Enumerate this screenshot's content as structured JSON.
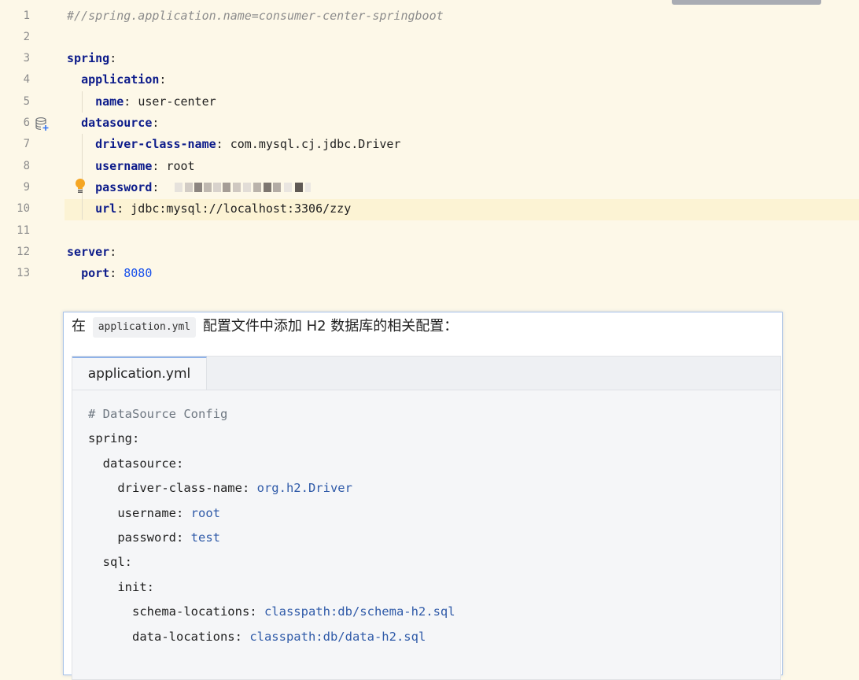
{
  "editor": {
    "line_numbers": [
      "1",
      "2",
      "3",
      "4",
      "5",
      "6",
      "7",
      "8",
      "9",
      "10",
      "11",
      "12",
      "13"
    ],
    "lines": [
      {
        "comment": "#//spring.application.name=consumer-center-springboot"
      },
      {},
      {
        "key": "spring",
        "colon": ":"
      },
      {
        "indent": "  ",
        "key": "application",
        "colon": ":"
      },
      {
        "indent": "    ",
        "key": "name",
        "colon": ": ",
        "value": "user-center"
      },
      {
        "indent": "  ",
        "key": "datasource",
        "colon": ":"
      },
      {
        "indent": "    ",
        "key": "driver-class-name",
        "colon": ": ",
        "value": "com.mysql.cj.jdbc.Driver"
      },
      {
        "indent": "    ",
        "key": "username",
        "colon": ": ",
        "value": "root"
      },
      {
        "indent": "    ",
        "key": "password",
        "colon": ": "
      },
      {
        "indent": "    ",
        "key": "url",
        "colon": ": ",
        "value": "jdbc:mysql://localhost:3306/zzy"
      },
      {},
      {
        "key": "server",
        "colon": ":"
      },
      {
        "indent": "  ",
        "key": "port",
        "colon": ": ",
        "number": "8080"
      }
    ],
    "gutter_icons": [
      "database-icon",
      "lightbulb-icon"
    ],
    "colors": {
      "background": "#fdf8e8",
      "key": "#0c1b8a",
      "number": "#1750eb",
      "comment": "#8c8c8c"
    }
  },
  "popup": {
    "intro_before": "在",
    "intro_code": "application.yml",
    "intro_after": "配置文件中添加 H2 数据库的相关配置：",
    "tab_label": "application.yml",
    "code_lines": [
      {
        "comment": "# DataSource Config"
      },
      {
        "key": "spring:"
      },
      {
        "key": "  datasource:"
      },
      {
        "key": "    driver-class-name: ",
        "value": "org.h2.Driver"
      },
      {
        "key": "    username: ",
        "value": "root"
      },
      {
        "key": "    password: ",
        "value": "test"
      },
      {
        "key": "  sql:"
      },
      {
        "key": "    init:"
      },
      {
        "key": "      schema-locations: ",
        "value": "classpath:db/schema-h2.sql"
      },
      {
        "key": "      data-locations: ",
        "value": "classpath:db/data-h2.sql"
      }
    ]
  }
}
